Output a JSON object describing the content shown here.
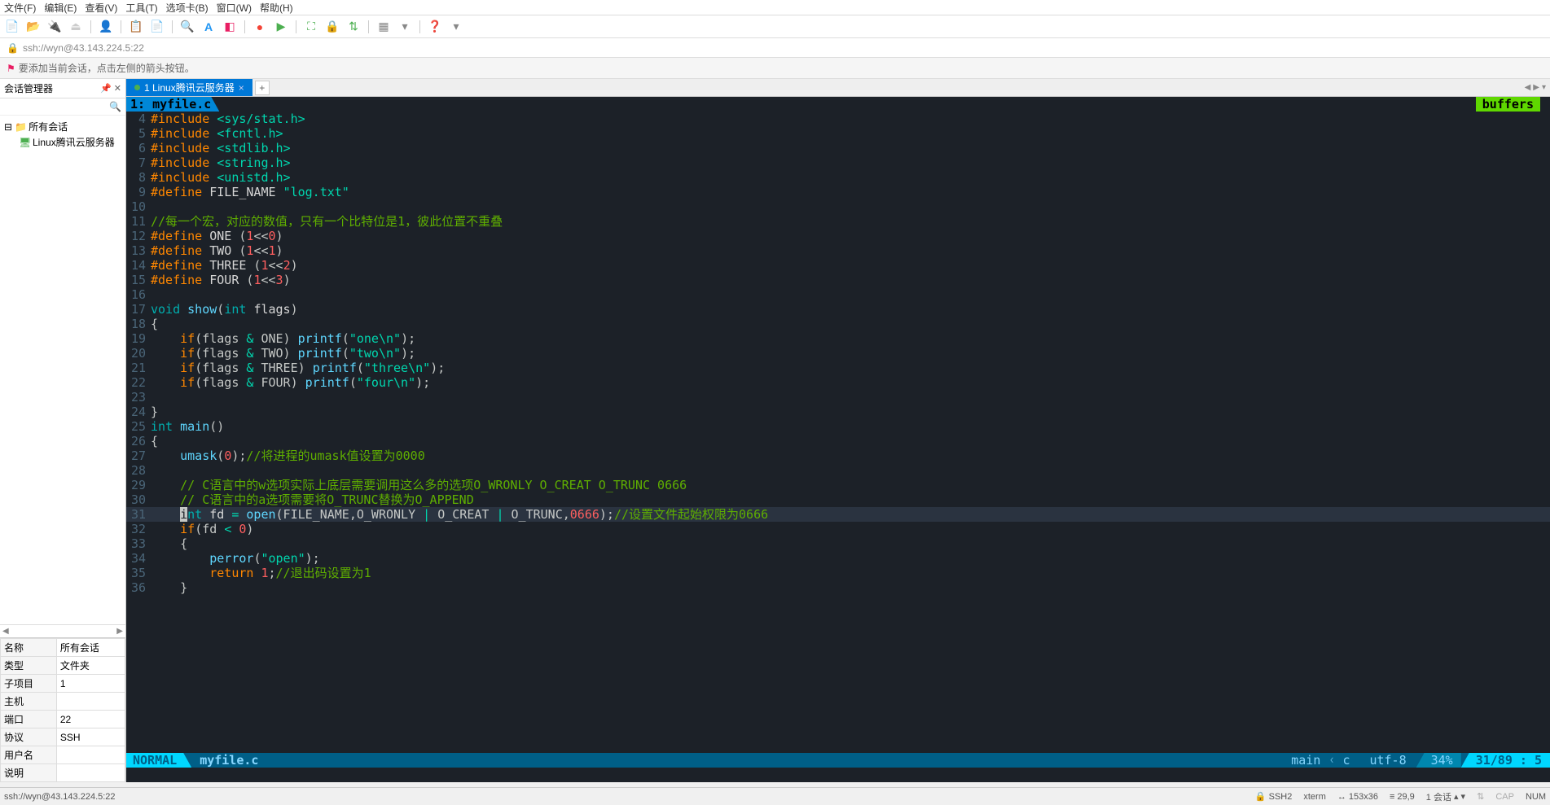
{
  "menu": {
    "items": [
      "文件(F)",
      "编辑(E)",
      "查看(V)",
      "工具(T)",
      "选项卡(B)",
      "窗口(W)",
      "帮助(H)"
    ]
  },
  "addressbar": {
    "url": "ssh://wyn@43.143.224.5:22"
  },
  "hint": {
    "text": "要添加当前会话，点击左侧的箭头按钮。"
  },
  "sidebar": {
    "title": "会话管理器",
    "root": "所有会话",
    "item1": "Linux腾讯云服务器",
    "props": [
      [
        "名称",
        "所有会话"
      ],
      [
        "类型",
        "文件夹"
      ],
      [
        "子项目",
        "1"
      ],
      [
        "主机",
        ""
      ],
      [
        "端口",
        "22"
      ],
      [
        "协议",
        "SSH"
      ],
      [
        "用户名",
        ""
      ],
      [
        "说明",
        ""
      ]
    ]
  },
  "tab": {
    "label": "1 Linux腾讯云服务器"
  },
  "editor": {
    "filetab": "1: myfile.c",
    "buffers": "buffers",
    "lines": [
      {
        "n": 4,
        "html": "<span class='pre'>#include</span> <span class='str'>&lt;sys/stat.h&gt;</span>"
      },
      {
        "n": 5,
        "html": "<span class='pre'>#include</span> <span class='str'>&lt;fcntl.h&gt;</span>"
      },
      {
        "n": 6,
        "html": "<span class='pre'>#include</span> <span class='str'>&lt;stdlib.h&gt;</span>"
      },
      {
        "n": 7,
        "html": "<span class='pre'>#include</span> <span class='str'>&lt;string.h&gt;</span>"
      },
      {
        "n": 8,
        "html": "<span class='pre'>#include</span> <span class='str'>&lt;unistd.h&gt;</span>"
      },
      {
        "n": 9,
        "html": "<span class='pre'>#define</span> <span class='var'>FILE_NAME</span> <span class='str'>\"log.txt\"</span>"
      },
      {
        "n": 10,
        "html": ""
      },
      {
        "n": 11,
        "html": "<span class='cm'>//每一个宏，对应的数值，只有一个比特位是1，彼此位置不重叠</span>"
      },
      {
        "n": 12,
        "html": "<span class='pre'>#define</span> <span class='var'>ONE</span> (<span class='num'>1</span>&lt;&lt;<span class='num'>0</span>)"
      },
      {
        "n": 13,
        "html": "<span class='pre'>#define</span> <span class='var'>TWO</span> (<span class='num'>1</span>&lt;&lt;<span class='num'>1</span>)"
      },
      {
        "n": 14,
        "html": "<span class='pre'>#define</span> <span class='var'>THREE</span> (<span class='num'>1</span>&lt;&lt;<span class='num'>2</span>)"
      },
      {
        "n": 15,
        "html": "<span class='pre'>#define</span> <span class='var'>FOUR</span> (<span class='num'>1</span>&lt;&lt;<span class='num'>3</span>)"
      },
      {
        "n": 16,
        "html": ""
      },
      {
        "n": 17,
        "html": "<span class='ty'>void</span> <span class='fn'>show</span>(<span class='ty'>int</span> <span class='var'>flags</span>)"
      },
      {
        "n": 18,
        "html": "{"
      },
      {
        "n": 19,
        "html": "    <span class='kw'>if</span>(flags <span class='op'>&amp;</span> ONE) <span class='fn'>printf</span>(<span class='str'>\"one\\n\"</span>);"
      },
      {
        "n": 20,
        "html": "    <span class='kw'>if</span>(flags <span class='op'>&amp;</span> TWO) <span class='fn'>printf</span>(<span class='str'>\"two\\n\"</span>);"
      },
      {
        "n": 21,
        "html": "    <span class='kw'>if</span>(flags <span class='op'>&amp;</span> THREE) <span class='fn'>printf</span>(<span class='str'>\"three\\n\"</span>);"
      },
      {
        "n": 22,
        "html": "    <span class='kw'>if</span>(flags <span class='op'>&amp;</span> FOUR) <span class='fn'>printf</span>(<span class='str'>\"four\\n\"</span>);"
      },
      {
        "n": 23,
        "html": ""
      },
      {
        "n": 24,
        "html": "}"
      },
      {
        "n": 25,
        "html": "<span class='ty'>int</span> <span class='fn'>main</span>()"
      },
      {
        "n": 26,
        "html": "{"
      },
      {
        "n": 27,
        "html": "    <span class='fn'>umask</span>(<span class='num'>0</span>);<span class='cm'>//将进程的umask值设置为0000</span>"
      },
      {
        "n": 28,
        "html": ""
      },
      {
        "n": 29,
        "html": "    <span class='cm'>// C语言中的w选项实际上底层需要调用这么多的选项O_WRONLY O_CREAT O_TRUNC 0666</span>"
      },
      {
        "n": 30,
        "html": "    <span class='cm'>// C语言中的a选项需要将O_TRUNC替换为O_APPEND</span>"
      },
      {
        "n": 31,
        "hl": true,
        "html": "    <span style='background:#c5c8c6;color:#1c2128'>i</span><span class='ty'>nt</span> <span class='var'>fd</span> <span class='op'>=</span> <span class='fn'>open</span>(FILE_NAME,O_WRONLY <span class='op'>|</span> O_CREAT <span class='op'>|</span> O_TRUNC,<span class='num'>0666</span>);<span class='cm'>//设置文件起始权限为0666</span>"
      },
      {
        "n": 32,
        "html": "    <span class='kw'>if</span>(fd <span class='op'>&lt;</span> <span class='num'>0</span>)"
      },
      {
        "n": 33,
        "html": "    {"
      },
      {
        "n": 34,
        "html": "        <span class='fn'>perror</span>(<span class='str'>\"open\"</span>);"
      },
      {
        "n": 35,
        "html": "        <span class='kw'>return</span> <span class='num'>1</span>;<span class='cm'>//退出码设置为1</span>"
      },
      {
        "n": 36,
        "html": "    }"
      }
    ],
    "status": {
      "mode": "NORMAL",
      "file": "myfile.c",
      "branch": "main",
      "ftype": "c",
      "encoding": "utf-8",
      "percent": "34%",
      "position": "31/89 :  5"
    }
  },
  "statusbar": {
    "path": "ssh://wyn@43.143.224.5:22",
    "ssh": "SSH2",
    "term": "xterm",
    "size": "153x36",
    "cursor": "29,9",
    "sess": "1 会话",
    "cap": "CAP",
    "num": "NUM"
  }
}
